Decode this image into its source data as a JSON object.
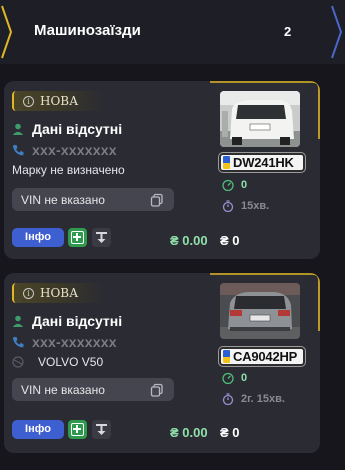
{
  "header": {
    "title": "Машинозаїзди",
    "count": "2"
  },
  "cards": [
    {
      "status": "НОВА",
      "client_name": "Дані відсутні",
      "phone": "xxx-xxxxxxx",
      "brand": "Марку не визначено",
      "vin": "VIN не вказано",
      "info_label": "Інфо",
      "amount_green": "₴ 0.00",
      "amount_white": "₴ 0",
      "plate": "DW241HK",
      "visits": "0",
      "duration": "15хв."
    },
    {
      "status": "НОВА",
      "client_name": "Дані відсутні",
      "phone": "xxx-xxxxxxx",
      "brand": "VOLVO V50",
      "vin": "VIN не вказано",
      "info_label": "Інфо",
      "amount_green": "₴ 0.00",
      "amount_white": "₴ 0",
      "plate": "CA9042HP",
      "visits": "0",
      "duration": "2г. 15хв."
    }
  ],
  "colors": {
    "accent_yellow": "#e0b624",
    "accent_blue": "#3e5fcf",
    "accent_green": "#8fe0a8",
    "card_bg": "#2b2b34",
    "page_bg": "#16161c"
  }
}
